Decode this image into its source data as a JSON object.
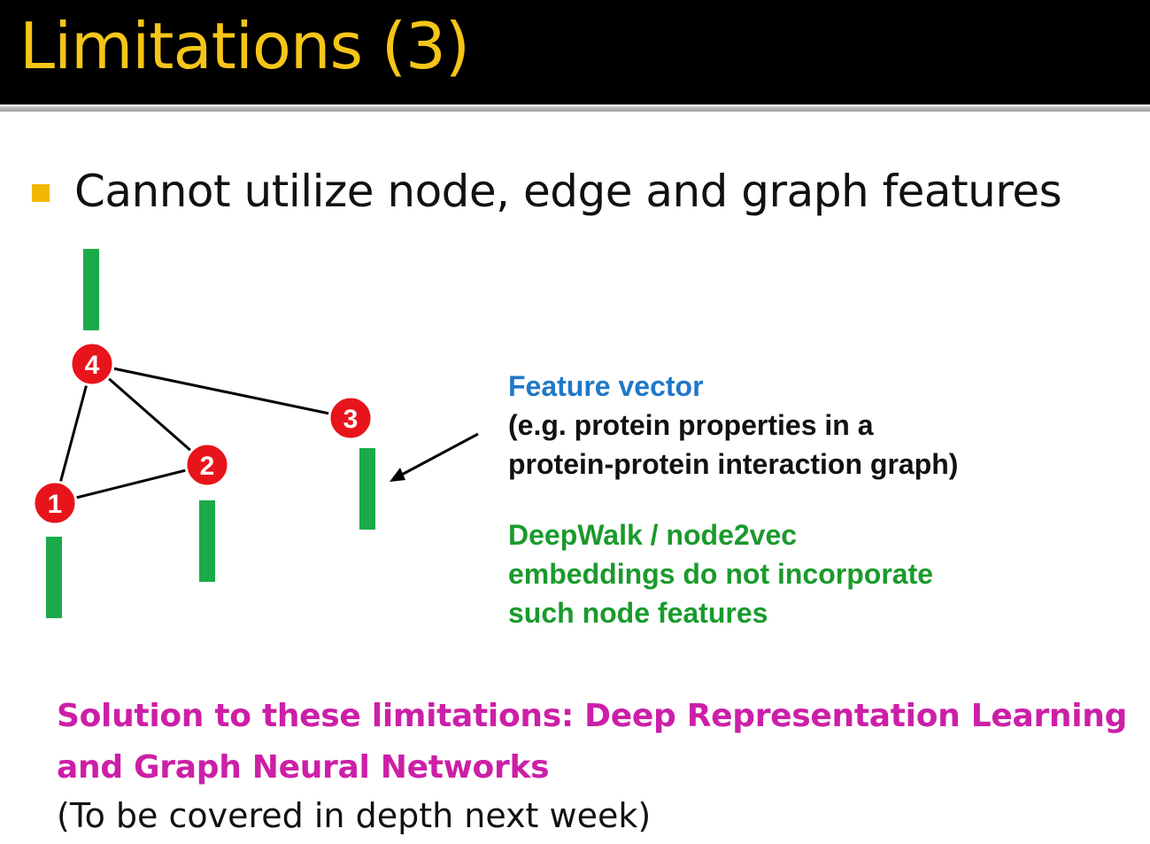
{
  "slide": {
    "title": "Limitations (3)",
    "bullet": "Cannot utilize node, edge and graph features"
  },
  "graph": {
    "nodes": [
      "1",
      "2",
      "3",
      "4"
    ],
    "edges": [
      [
        "4",
        "1"
      ],
      [
        "4",
        "2"
      ],
      [
        "4",
        "3"
      ],
      [
        "1",
        "2"
      ]
    ]
  },
  "feature_vector": {
    "title": "Feature vector",
    "desc_lines": [
      "(e.g. protein properties in a",
      "protein-protein interaction graph)"
    ]
  },
  "deepwalk_note": {
    "lines": [
      "DeepWalk / node2vec",
      "embeddings do not incorporate",
      "such node features"
    ]
  },
  "solution": {
    "lines": [
      "Solution to these limitations: Deep Representation Learning",
      "and Graph Neural Networks"
    ]
  },
  "note": "(To be covered in depth next week)",
  "colors": {
    "title": "#f5c518",
    "node_fill": "#e8141b",
    "feature_bar": "#1aaa4a",
    "feature_title": "#1f78c8",
    "deepwalk_text": "#1a9a2c",
    "solution_text": "#cc1fa7",
    "bullet": "#f2b705"
  }
}
